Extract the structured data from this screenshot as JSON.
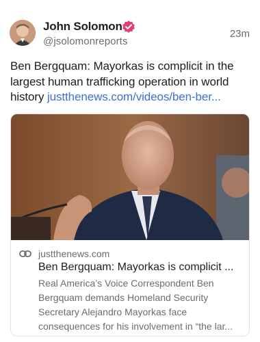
{
  "author": {
    "name": "John Solomon",
    "handle": "@jsolomonreports",
    "timestamp": "23m",
    "verified_color": "#e0407a"
  },
  "post": {
    "text": "Ben Bergquam: Mayorkas is complicit in the largest human trafficking operation in world history",
    "link_text": "justthenews.com/videos/ben-ber..."
  },
  "link_card": {
    "domain": "justthenews.com",
    "title": "Ben Bergquam: Mayorkas is complicit ...",
    "description": "Real America’s Voice Correspondent Ben Bergquam demands Homeland Security Secretary Alejandro Mayorkas face consequences for his involvement in “the lar..."
  },
  "colors": {
    "link": "#3e6fd6",
    "muted_text": "#6b6b73"
  }
}
